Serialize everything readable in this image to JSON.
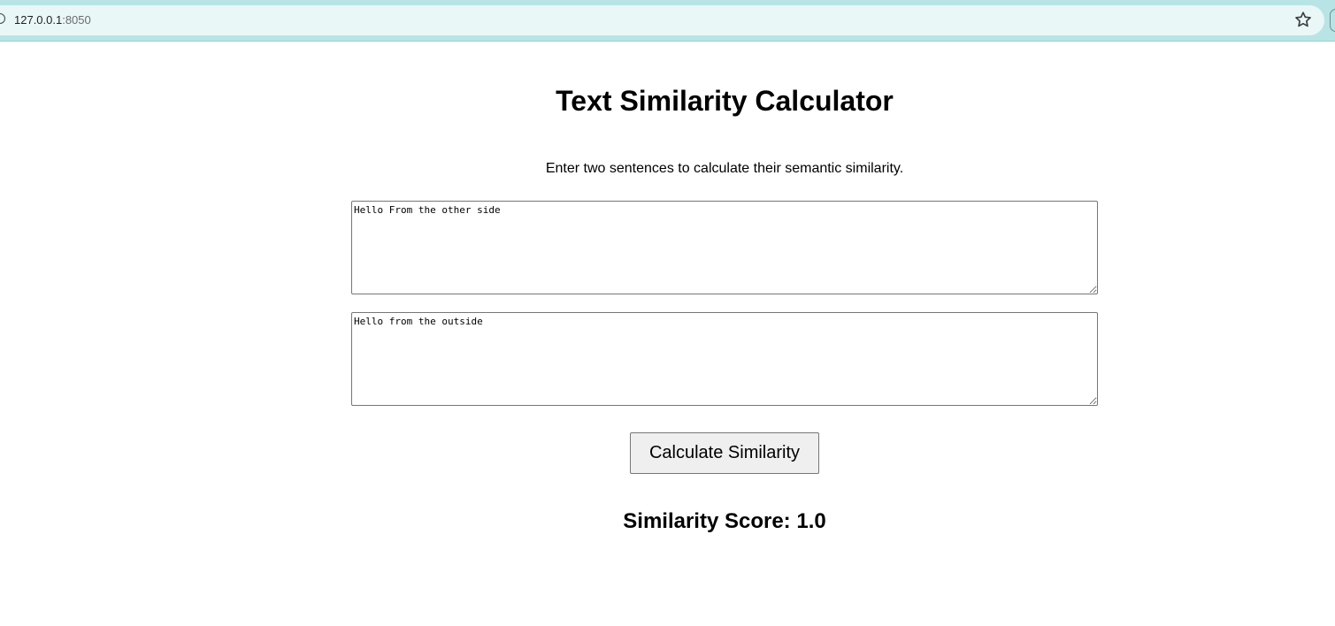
{
  "browser": {
    "url_host": "127.0.0.1",
    "url_port": ":8050",
    "icons": [
      "site-info-icon",
      "bookmark-star-icon"
    ]
  },
  "page": {
    "title": "Text Similarity Calculator",
    "instructions": "Enter two sentences to calculate their semantic similarity.",
    "sentence_1": "Hello From the other side",
    "sentence_2": "Hello from the outside",
    "button_label": "Calculate Similarity",
    "result_text": "Similarity Score: 1.0"
  },
  "colors": {
    "browser_chrome": "#b9e4e6",
    "omnibox": "#eaf7f7",
    "button_bg": "#efefef"
  }
}
